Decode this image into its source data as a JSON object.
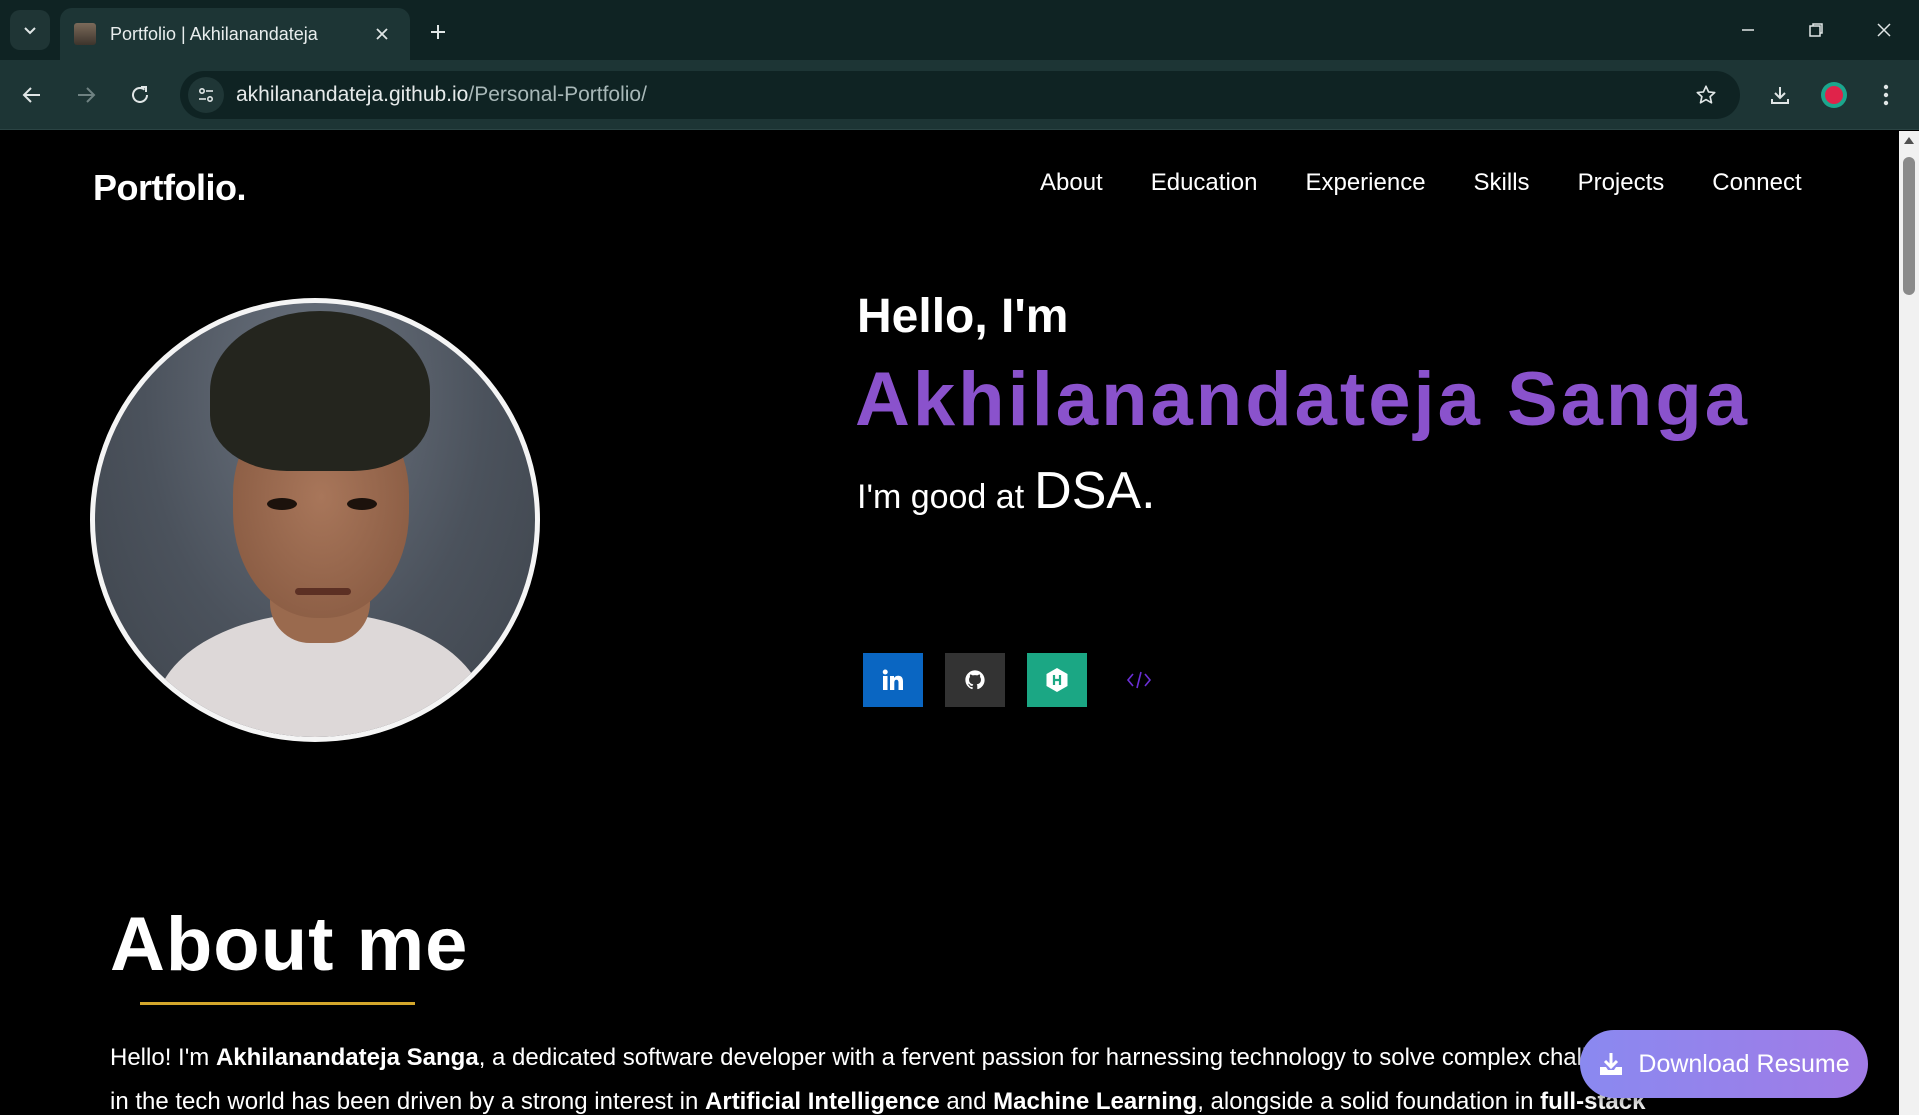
{
  "browser": {
    "tab_title": "Portfolio | Akhilanandateja",
    "url_host": "akhilanandateja.github.io",
    "url_path": "/Personal-Portfolio/"
  },
  "header": {
    "logo": "Portfolio.",
    "nav": [
      "About",
      "Education",
      "Experience",
      "Skills",
      "Projects",
      "Connect"
    ]
  },
  "hero": {
    "greeting": "Hello, I'm",
    "name": "Akhilanandateja Sanga",
    "tagline_prefix": "I'm good at",
    "tagline_skill": "DSA.",
    "socials": [
      {
        "icon": "linkedin-icon",
        "color": "#0a66c2"
      },
      {
        "icon": "github-icon",
        "color": "#333333"
      },
      {
        "icon": "hackerrank-icon",
        "color": "#1ba784"
      },
      {
        "icon": "code-icon",
        "color": "#6b2fd6"
      }
    ]
  },
  "about": {
    "title": "About me",
    "p1_a": "Hello! I'm ",
    "p1_b": "Akhilanandateja Sanga",
    "p1_c": ", a dedicated software developer with a fervent passion for harnessing technology to solve complex chall",
    "p2_a": "in the tech world has been driven by a strong interest in ",
    "p2_b": "Artificial Intelligence",
    "p2_c": " and ",
    "p2_d": "Machine Learning",
    "p2_e": ", alongside a solid foundation in ",
    "p2_f": "full-stack"
  },
  "resume_button": "Download Resume",
  "colors": {
    "accent_purple": "#8a52cc",
    "underline_gold": "#d4a72c",
    "button_gradient_start": "#8a89f0",
    "button_gradient_end": "#a07be6"
  }
}
